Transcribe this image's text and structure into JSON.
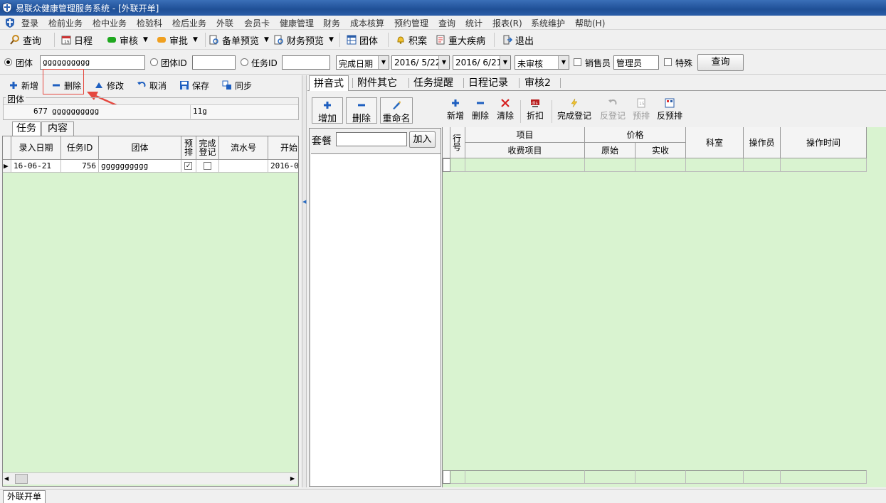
{
  "window": {
    "title": "易联众健康管理服务系统 - [外联开单]"
  },
  "menu": [
    "登录",
    "检前业务",
    "检中业务",
    "检验科",
    "检后业务",
    "外联",
    "会员卡",
    "健康管理",
    "财务",
    "成本核算",
    "预约管理",
    "查询",
    "统计",
    "报表(R)",
    "系统维护",
    "帮助(H)"
  ],
  "toolbar": {
    "query": "查询",
    "schedule": "日程",
    "audit": "审核",
    "approve": "审批",
    "order_preview": "备单预览",
    "finance_preview": "财务预览",
    "group": "团体",
    "backlog": "积案",
    "major_disease": "重大疾病",
    "exit": "退出"
  },
  "filter": {
    "group_label": "团体",
    "group_value": "gggggggggg",
    "group_id_label": "团体ID",
    "group_id_value": "",
    "task_id_label": "任务ID",
    "task_id_value": "",
    "date_type": "完成日期",
    "date_from": "2016/ 5/22",
    "date_to": "2016/ 6/21",
    "audit_status": "未审核",
    "salesperson_label": "销售员",
    "salesperson_value": "管理员",
    "special_label": "特殊",
    "query_button": "查询"
  },
  "left_toolbar": {
    "add": "新增",
    "delete": "删除",
    "edit": "修改",
    "cancel": "取消",
    "save": "保存",
    "sync": "同步"
  },
  "group_box": {
    "legend": "团体",
    "id": "677",
    "name": "gggggggggg",
    "extra": "11g"
  },
  "left_tabs": [
    "任务",
    "内容"
  ],
  "task_grid": {
    "headers": [
      "录入日期",
      "任务ID",
      "团体",
      "预排",
      "完成登记",
      "流水号",
      "开始"
    ],
    "rows": [
      {
        "date": "16-06-21",
        "task_id": "756",
        "group": "gggggggggg",
        "pre": true,
        "done": false,
        "serial": "",
        "start": "2016-0"
      }
    ]
  },
  "right_tabs": [
    "拼音式",
    "附件其它",
    "任务提醒",
    "日程记录",
    "审核2"
  ],
  "package_toolbar": {
    "add": "增加",
    "delete": "删除",
    "rename": "重命名"
  },
  "package": {
    "label": "套餐",
    "value": "",
    "join_button": "加入"
  },
  "item_toolbar": {
    "add": "新增",
    "delete": "删除",
    "clear": "清除",
    "discount": "折扣",
    "complete_reg": "完成登记",
    "reverse_reg": "反登记",
    "prearrange": "预排",
    "reverse_prearrange": "反预排"
  },
  "item_grid": {
    "row_header": "行号",
    "item": "项目",
    "charge_item": "收费项目",
    "price": "价格",
    "original": "原始",
    "actual": "实收",
    "dept": "科室",
    "operator": "操作员",
    "op_time": "操作时间"
  },
  "status": {
    "tab": "外联开单"
  }
}
